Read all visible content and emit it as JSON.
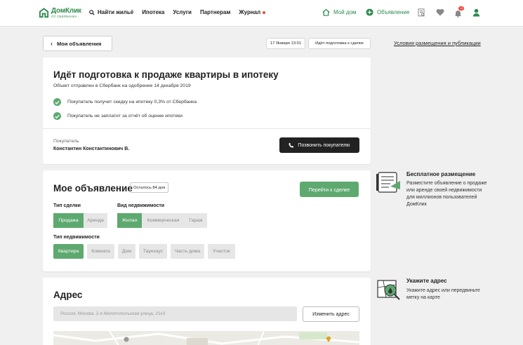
{
  "header": {
    "logo_name": "ДомКлик",
    "logo_sub": "ОТ СБЕРБАНКА",
    "nav": [
      {
        "label": "Найти жильё"
      },
      {
        "label": "Ипотека"
      },
      {
        "label": "Услуги"
      },
      {
        "label": "Партнерам"
      },
      {
        "label": "Журнал"
      }
    ],
    "my_home": "Мой дом",
    "ad_label": "Объявление",
    "notification_count": "12"
  },
  "toolbar": {
    "back_label": "Мои объявления",
    "date_chip": "17 Января 13:01",
    "status_chip": "Идёт подготовка к сделке",
    "conditions_link": "Условия размещения и публикации"
  },
  "status_card": {
    "title": "Идёт подготовка к продаже квартиры в ипотеку",
    "subtitle": "Объект отправлен в Сбербанк на одобрение 14 декабря 2019",
    "checks": [
      "Покупатель получит скидку на ипотеку 0,3% от Сбербанка",
      "Покупатель не заплатит за отчёт об оценке ипотеки"
    ],
    "buyer_label": "Покупатель",
    "buyer_name": "Константин Константинович В.",
    "call_button": "Позвонить покупателю"
  },
  "listing_card": {
    "title": "Мое объявление",
    "days_left": "Осталось 84 дня",
    "goto_button": "Перейти к сделке",
    "deal_type_label": "Тип сделки",
    "deal_types": [
      "Продажа",
      "Аренда"
    ],
    "property_kind_label": "Вид недвижимости",
    "property_kinds": [
      "Жилая",
      "Коммерческая",
      "Гараж"
    ],
    "property_type_label": "Тип недвижимости",
    "property_types": [
      "Квартира",
      "Комната",
      "Дом",
      "Таунхаус",
      "Часть дома",
      "Участок"
    ]
  },
  "address_card": {
    "title": "Адрес",
    "address_value": "Россия, Москва, 2-я Мелитопольская улица, 21к3",
    "change_button": "Изменить адрес"
  },
  "sidebar": {
    "free_title": "Бесплатное размещение",
    "free_text": "Разместите объявление о продаже или аренде своей недвижимости для миллионов пользователей ДомКлик",
    "address_title": "Укажите адрес",
    "address_text": "Укажите адрес или передвиньте метку на карте"
  },
  "colors": {
    "accent": "#5ea96f",
    "brand": "#2c8a4b",
    "dark_button": "#222222",
    "notification": "#e8473e"
  }
}
